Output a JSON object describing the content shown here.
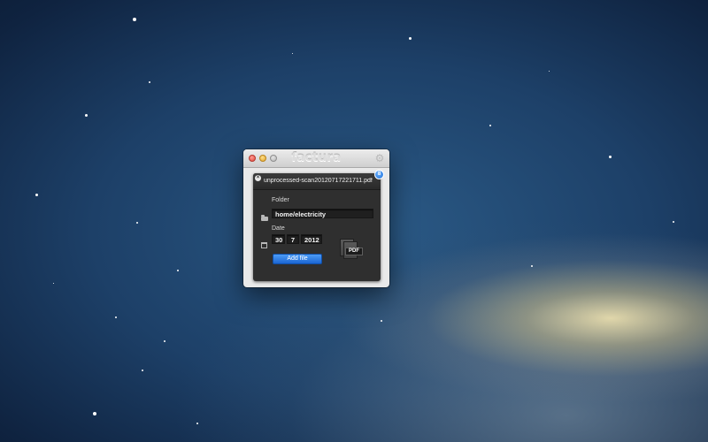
{
  "window": {
    "app_title": "factura",
    "settings_icon": "gear-icon"
  },
  "card": {
    "filename": "unprocessed-scan20120717221711.pdf",
    "badge": "8",
    "folder_label": "Folder",
    "folder_value": "home/electricity",
    "date_label": "Date",
    "date_day": "30",
    "date_month": "7",
    "date_year": "2012",
    "file_type": "PDF",
    "add_button": "Add file"
  },
  "colors": {
    "accent": "#1c66d3",
    "card_bg": "#2f2f2f"
  }
}
